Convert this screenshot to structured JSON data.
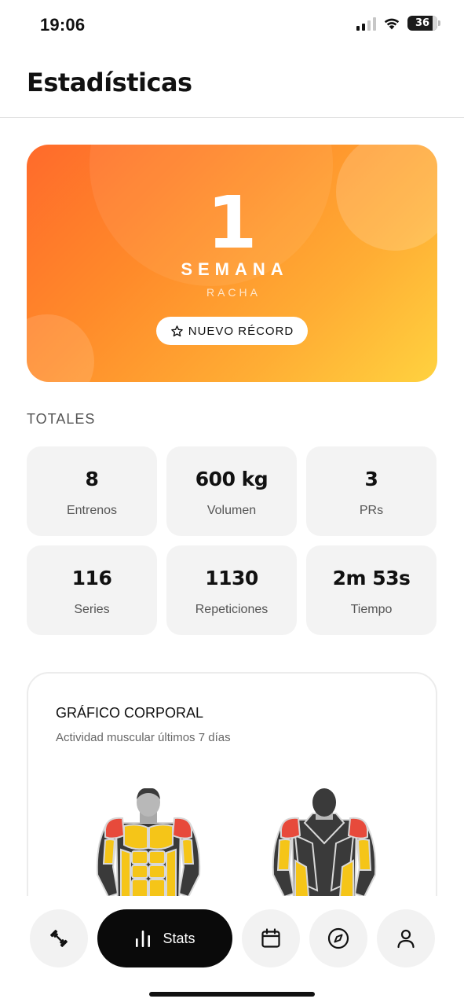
{
  "status_bar": {
    "time": "19:06",
    "battery": "36"
  },
  "header": {
    "title": "Estadísticas"
  },
  "streak": {
    "value": "1",
    "unit": "SEMANA",
    "label": "RACHA",
    "badge": "NUEVO RÉCORD",
    "badge_icon": "star-icon",
    "colors": {
      "gradient_start": "#ff6a2b",
      "gradient_end": "#ffd23f"
    }
  },
  "totals": {
    "section_label": "TOTALES",
    "items": [
      {
        "value": "8",
        "label": "Entrenos"
      },
      {
        "value": "600 kg",
        "label": "Volumen"
      },
      {
        "value": "3",
        "label": "PRs"
      },
      {
        "value": "116",
        "label": "Series"
      },
      {
        "value": "1130",
        "label": "Repeticiones"
      },
      {
        "value": "2m 53s",
        "label": "Tiempo"
      }
    ]
  },
  "body_chart": {
    "title": "GRÁFICO CORPORAL",
    "subtitle": "Actividad muscular últimos 7 días",
    "views": [
      "front",
      "back"
    ],
    "colors": {
      "high": "#e74a3b",
      "medium": "#f5c518",
      "inactive": "#3a3a3a",
      "head": "#b8b8b8"
    }
  },
  "nav": {
    "items": [
      {
        "icon": "dumbbell-icon"
      },
      {
        "icon": "bar-chart-icon",
        "label": "Stats",
        "active": true
      },
      {
        "icon": "calendar-icon"
      },
      {
        "icon": "compass-icon"
      },
      {
        "icon": "person-icon"
      }
    ],
    "active_label": "Stats"
  }
}
